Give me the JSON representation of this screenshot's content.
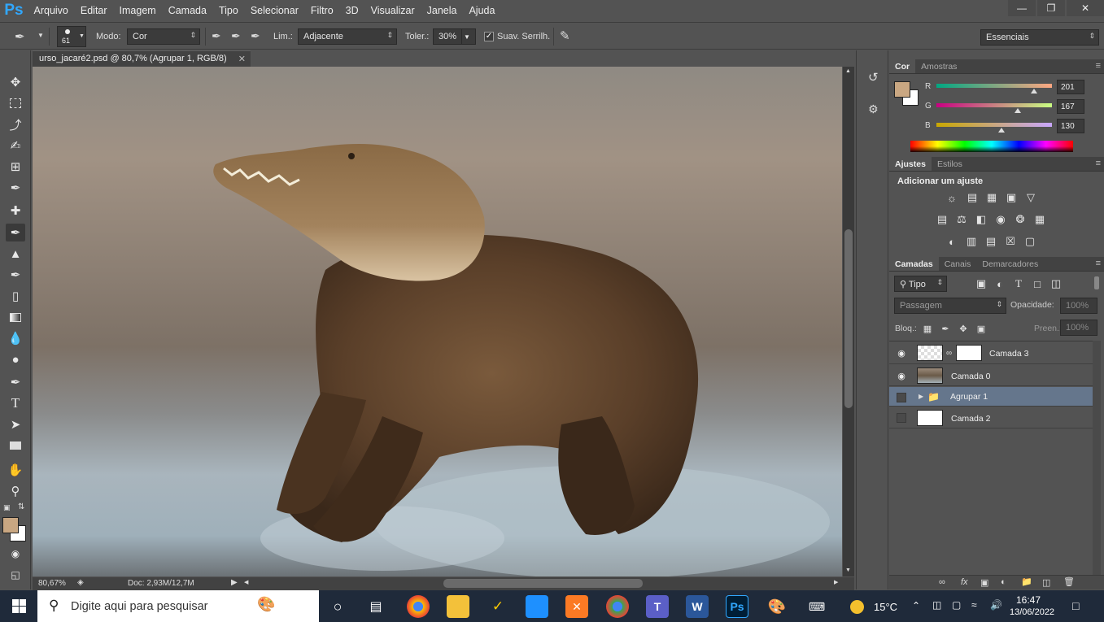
{
  "app": {
    "logo": "Ps",
    "menu": [
      "Arquivo",
      "Editar",
      "Imagem",
      "Camada",
      "Tipo",
      "Selecionar",
      "Filtro",
      "3D",
      "Visualizar",
      "Janela",
      "Ajuda"
    ]
  },
  "options": {
    "brush_size": "61",
    "mode_label": "Modo:",
    "mode_value": "Cor",
    "limits_label": "Lim.:",
    "limits_value": "Adjacente",
    "tolerance_label": "Toler.:",
    "tolerance_value": "30%",
    "antialias_label": "Suav. Serrilh.",
    "workspace_value": "Essenciais"
  },
  "document": {
    "tab_title": "urso_jacaré2.psd @ 80,7% (Agrupar 1, RGB/8)",
    "zoom": "80,67%",
    "doc_info": "Doc: 2,93M/12,7M"
  },
  "color_panel": {
    "tabs": [
      "Cor",
      "Amostras"
    ],
    "r_label": "R",
    "r_value": "201",
    "g_label": "G",
    "g_value": "167",
    "b_label": "B",
    "b_value": "130",
    "foreground": "#c9a782"
  },
  "adjust_panel": {
    "tabs": [
      "Ajustes",
      "Estilos"
    ],
    "heading": "Adicionar um ajuste"
  },
  "layers_panel": {
    "tabs": [
      "Camadas",
      "Canais",
      "Demarcadores"
    ],
    "filter_kind": "Tipo",
    "blend_mode": "Passagem",
    "opacity_label": "Opacidade:",
    "opacity_value": "100%",
    "lock_label": "Bloq.:",
    "fill_label": "Preen.:",
    "fill_value": "100%",
    "layers": [
      {
        "name": "Camada 3",
        "visible": true
      },
      {
        "name": "Camada 0",
        "visible": true
      },
      {
        "name": "Agrupar 1",
        "visible": false,
        "selected": true
      },
      {
        "name": "Camada 2",
        "visible": false
      }
    ]
  },
  "taskbar": {
    "search_placeholder": "Digite aqui para pesquisar",
    "temperature": "15°C",
    "time": "16:47",
    "date": "13/06/2022"
  }
}
